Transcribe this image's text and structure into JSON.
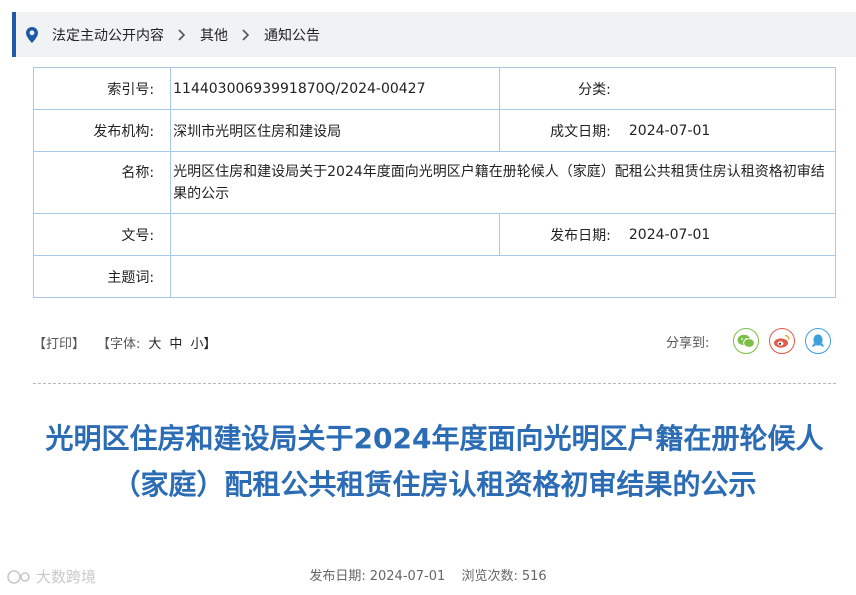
{
  "breadcrumb": {
    "items": [
      "法定主动公开内容",
      "其他",
      "通知公告"
    ]
  },
  "meta": {
    "index_label": "索引号:",
    "index_value": "11440300693991870Q/2024-00427",
    "category_label": "分类:",
    "category_value": "",
    "publisher_label": "发布机构:",
    "publisher_value": "深圳市光明区住房和建设局",
    "created_label": "成文日期:",
    "created_value": "2024-07-01",
    "name_label": "名称:",
    "name_value": "光明区住房和建设局关于2024年度面向光明区户籍在册轮候人（家庭）配租公共租赁住房认租资格初审结果的公示",
    "docno_label": "文号:",
    "docno_value": "",
    "pubdate_label": "发布日期:",
    "pubdate_value": "2024-07-01",
    "keywords_label": "主题词:",
    "keywords_value": ""
  },
  "toolbar": {
    "print": "【打印】",
    "font_open": "【字体:",
    "font_large": "大",
    "font_medium": "中",
    "font_small": "小】",
    "share_label": "分享到:"
  },
  "article": {
    "title": "光明区住房和建设局关于2024年度面向光明区户籍在册轮候人（家庭）配租公共租赁住房认租资格初审结果的公示",
    "pubdate_label": "发布日期:",
    "pubdate_value": "2024-07-01",
    "views_label": "浏览次数:",
    "views_value": "516"
  },
  "watermark": "大数跨境",
  "colors": {
    "accent": "#1e5aa8",
    "title": "#2b6cb5",
    "table_border": "#a9c7e6",
    "wechat": "#7bbf46",
    "weibo": "#e25a4a",
    "qq": "#3ea1dc"
  },
  "icons": [
    "location-pin-icon",
    "chevron-right-icon",
    "wechat-icon",
    "weibo-icon",
    "qq-icon"
  ]
}
